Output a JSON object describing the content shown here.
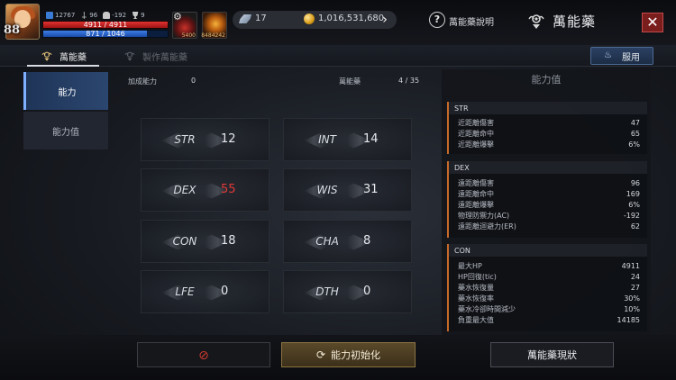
{
  "player": {
    "level": "88",
    "stat_a": "12767",
    "stat_b": "96",
    "stat_c": "-192",
    "stat_d": "9",
    "hp": "4911 / 4911",
    "hp_fraction": 1.0,
    "mp": "871 / 1046",
    "mp_fraction": 0.833
  },
  "buffs": [
    {
      "icon": "potion-icon",
      "count": "5400"
    },
    {
      "icon": "flame-icon",
      "count": "8484242"
    }
  ],
  "currency": {
    "gems": "17",
    "gold": "1,016,531,680"
  },
  "header": {
    "help_label": "萬能藥說明",
    "title": "萬能藥",
    "close_symbol": "✕"
  },
  "tabs": {
    "elixir": "萬能藥",
    "craft": "製作萬能藥",
    "use_button": "服用"
  },
  "sidenav": {
    "ability": "能力",
    "stats": "能力值"
  },
  "summary": {
    "combine_label": "加成能力",
    "combine_value": "0",
    "elixir_label": "萬能藥",
    "elixir_value": "4 / 35"
  },
  "stats": [
    {
      "name": "STR",
      "value": "12",
      "highlight": false
    },
    {
      "name": "INT",
      "value": "14",
      "highlight": false
    },
    {
      "name": "DEX",
      "value": "55",
      "highlight": true
    },
    {
      "name": "WIS",
      "value": "31",
      "highlight": false
    },
    {
      "name": "CON",
      "value": "18",
      "highlight": false
    },
    {
      "name": "CHA",
      "value": "8",
      "highlight": false
    },
    {
      "name": "LFE",
      "value": "0",
      "highlight": false
    },
    {
      "name": "DTH",
      "value": "0",
      "highlight": false
    }
  ],
  "ability_panel": {
    "title": "能力值",
    "sections": [
      {
        "header": "STR",
        "rows": [
          {
            "label": "近距離傷害",
            "value": "47"
          },
          {
            "label": "近距離命中",
            "value": "65"
          },
          {
            "label": "近距離爆擊",
            "value": "6%"
          }
        ]
      },
      {
        "header": "DEX",
        "rows": [
          {
            "label": "遠距離傷害",
            "value": "96"
          },
          {
            "label": "遠距離命中",
            "value": "169"
          },
          {
            "label": "遠距離爆擊",
            "value": "6%"
          },
          {
            "label": "物理防禦力(AC)",
            "value": "-192"
          },
          {
            "label": "遠距離迴避力(ER)",
            "value": "62"
          }
        ]
      },
      {
        "header": "CON",
        "rows": [
          {
            "label": "最大HP",
            "value": "4911"
          },
          {
            "label": "HP回復(tic)",
            "value": "24"
          },
          {
            "label": "藥水恢復量",
            "value": "27"
          },
          {
            "label": "藥水恢復率",
            "value": "30%"
          },
          {
            "label": "藥水冷卻時間減少",
            "value": "10%"
          },
          {
            "label": "負重最大值",
            "value": "14185"
          }
        ]
      }
    ]
  },
  "bottom": {
    "reset_label": "能力初始化",
    "status_label": "萬能藥現狀"
  },
  "colors": {
    "accent_blue": "#2b466f",
    "hp_red": "#e23232",
    "mp_blue": "#3e7ee6",
    "highlight_red": "#e23838",
    "section_orange": "#c66a2a"
  }
}
